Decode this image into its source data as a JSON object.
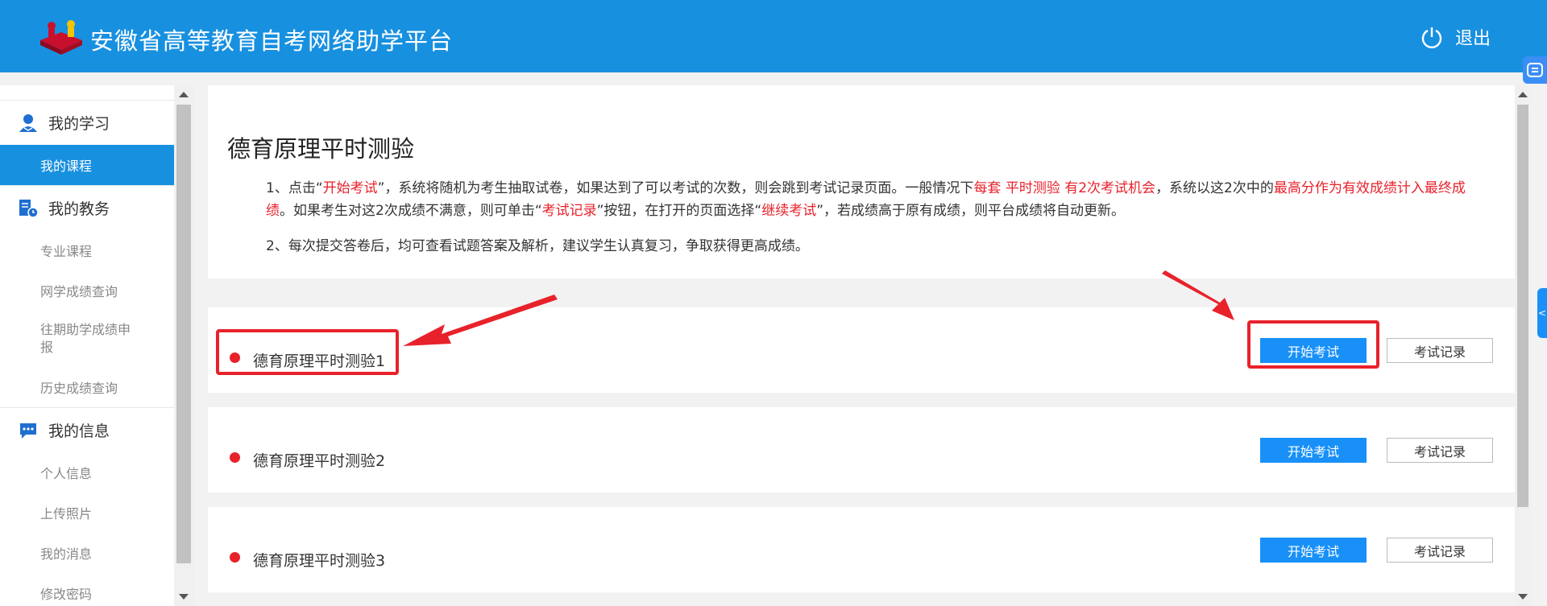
{
  "header": {
    "title": "安徽省高等教育自考网络助学平台",
    "logout_label": "退出"
  },
  "sidebar": {
    "groups": [
      {
        "label": "我的学习",
        "icon": "user-icon",
        "items": [
          {
            "label": "我的课程",
            "active": true
          }
        ]
      },
      {
        "label": "我的教务",
        "icon": "schedule-icon",
        "items": [
          {
            "label": "专业课程"
          },
          {
            "label": "网学成绩查询"
          },
          {
            "label": "往期助学成绩申报"
          },
          {
            "label": "历史成绩查询"
          }
        ]
      },
      {
        "label": "我的信息",
        "icon": "chat-icon",
        "items": [
          {
            "label": "个人信息"
          },
          {
            "label": "上传照片"
          },
          {
            "label": "我的消息"
          },
          {
            "label": "修改密码"
          }
        ]
      }
    ]
  },
  "main": {
    "title": "德育原理平时测验",
    "note1": {
      "p1": "1、点击“",
      "r1": "开始考试",
      "p2": "”，系统将随机为考生抽取试卷，如果达到了可以考试的次数，则会跳到考试记录页面。一般情况下",
      "r2": "每套 平时测验 有2次考试机会",
      "p3": "，系统以这2次中的",
      "r3": "最高分作为有效成绩计入最终成绩",
      "p4": "。如果考生对这2次成绩不满意，则可单击“",
      "r4": "考试记录",
      "p5": "”按钮，在打开的页面选择“",
      "r5": "继续考试",
      "p6": "”，若成绩高于原有成绩，则平台成绩将自动更新。"
    },
    "note2": "2、每次提交答卷后，均可查看试题答案及解析，建议学生认真复习，争取获得更高成绩。",
    "exams": [
      {
        "name": "德育原理平时测验1",
        "start_label": "开始考试",
        "record_label": "考试记录"
      },
      {
        "name": "德育原理平时测验2",
        "start_label": "开始考试",
        "record_label": "考试记录"
      },
      {
        "name": "德育原理平时测验3",
        "start_label": "开始考试",
        "record_label": "考试记录"
      }
    ]
  },
  "side_tab_label": "<",
  "colors": {
    "header": "#1890e0",
    "accent": "#1890f8",
    "highlight": "#e8222b"
  }
}
